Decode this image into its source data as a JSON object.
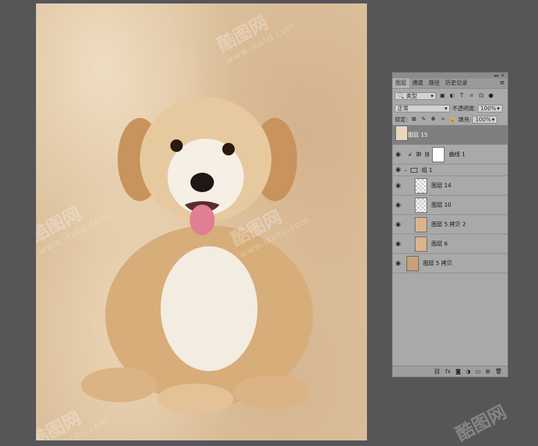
{
  "panel": {
    "tabs": [
      {
        "label": "图层",
        "active": true
      },
      {
        "label": "通道",
        "active": false
      },
      {
        "label": "路径",
        "active": false
      },
      {
        "label": "历史记录",
        "active": false
      }
    ],
    "filter": {
      "label": "类型"
    },
    "blend_mode": "正常",
    "opacity_label": "不透明度:",
    "opacity_value": "100%",
    "lock_label": "锁定:",
    "fill_label": "填充:",
    "fill_value": "100%",
    "layers": [
      {
        "name": "图层 15",
        "selected": true,
        "thumb": "dog"
      },
      {
        "name": "曲线 1",
        "type": "adjustment"
      },
      {
        "name": "组 1",
        "type": "group"
      },
      {
        "name": "图层 14",
        "thumb": "check"
      },
      {
        "name": "图层 10",
        "thumb": "check"
      },
      {
        "name": "图层 5 拷贝 2",
        "thumb": "tan"
      },
      {
        "name": "图层 6",
        "thumb": "tan"
      },
      {
        "name": "图层 5 拷贝",
        "thumb": "dark"
      }
    ],
    "bottom_icons": [
      "link-icon",
      "fx-icon",
      "mask-icon",
      "adjustment-icon",
      "folder-icon",
      "new-layer-icon",
      "trash-icon"
    ],
    "bottom_labels": {
      "fx": "fx"
    }
  },
  "watermark": {
    "logo": "酷图网",
    "url": "www.ikutu.com"
  },
  "colors": {
    "workspace": "#555658",
    "panel": "#a9a9a9",
    "selected_layer": "#7f7f7f"
  }
}
